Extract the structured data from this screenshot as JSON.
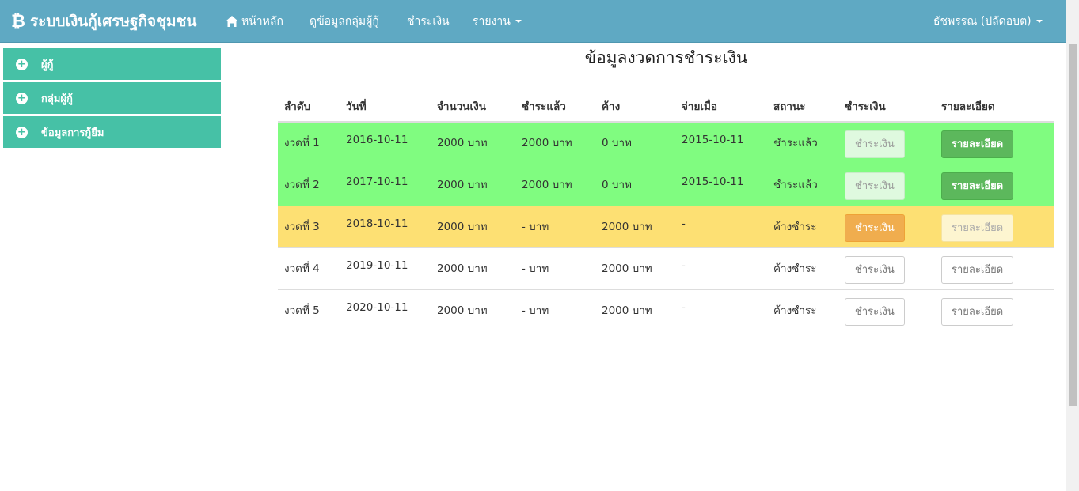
{
  "navbar": {
    "brand": "ระบบเงินกู้เศรษฐกิจชุมชน",
    "brand_icon": "bitcoin-icon",
    "home": "หน้าหลัก",
    "group_info": "ดูข้อมูลกลุ่มผู้กู้",
    "payment": "ชำระเงิน",
    "report": "รายงาน",
    "user": "ธัชพรรณ (ปลัดอบต)"
  },
  "sidebar": {
    "items": [
      {
        "label": "ผู้กู้",
        "icon": "plus-circle-icon"
      },
      {
        "label": "กลุ่มผู้กู้",
        "icon": "plus-circle-icon"
      },
      {
        "label": "ข้อมูลการกู้ยืม",
        "icon": "plus-circle-icon"
      }
    ]
  },
  "main": {
    "title": "ข้อมูลงวดการชำระเงิน",
    "columns": [
      "ลำดับ",
      "วันที่",
      "จำนวนเงิน",
      "ชำระแล้ว",
      "ค้าง",
      "จ่ายเมื่อ",
      "สถานะ",
      "ชำระเงิน",
      "รายละเอียด"
    ],
    "rows": [
      {
        "no": "งวดที่ 1",
        "date": "2016-10-11",
        "amount": "2000 บาท",
        "paid": "2000 บาท",
        "owed": "0 บาท",
        "paid_on": "2015-10-11",
        "status": "ชำระแล้ว",
        "pay_btn": "ชำระเงิน",
        "detail_btn": "รายละเอียด",
        "state": "paid"
      },
      {
        "no": "งวดที่ 2",
        "date": "2017-10-11",
        "amount": "2000 บาท",
        "paid": "2000 บาท",
        "owed": "0 บาท",
        "paid_on": "2015-10-11",
        "status": "ชำระแล้ว",
        "pay_btn": "ชำระเงิน",
        "detail_btn": "รายละเอียด",
        "state": "paid"
      },
      {
        "no": "งวดที่ 3",
        "date": "2018-10-11",
        "amount": "2000 บาท",
        "paid": "- บาท",
        "owed": "2000 บาท",
        "paid_on": "-",
        "status": "ค้างชำระ",
        "pay_btn": "ชำระเงิน",
        "detail_btn": "รายละเอียด",
        "state": "due"
      },
      {
        "no": "งวดที่ 4",
        "date": "2019-10-11",
        "amount": "2000 บาท",
        "paid": "- บาท",
        "owed": "2000 บาท",
        "paid_on": "-",
        "status": "ค้างชำระ",
        "pay_btn": "ชำระเงิน",
        "detail_btn": "รายละเอียด",
        "state": "pending"
      },
      {
        "no": "งวดที่ 5",
        "date": "2020-10-11",
        "amount": "2000 บาท",
        "paid": "- บาท",
        "owed": "2000 บาท",
        "paid_on": "-",
        "status": "ค้างชำระ",
        "pay_btn": "ชำระเงิน",
        "detail_btn": "รายละเอียด",
        "state": "pending"
      }
    ]
  },
  "colors": {
    "navbar": "#5fa9c3",
    "sidebar": "#46c1a6",
    "paid_row": "#80fc80",
    "due_row": "#fde073",
    "success": "#5cb85c",
    "warning": "#f0ad4e"
  }
}
